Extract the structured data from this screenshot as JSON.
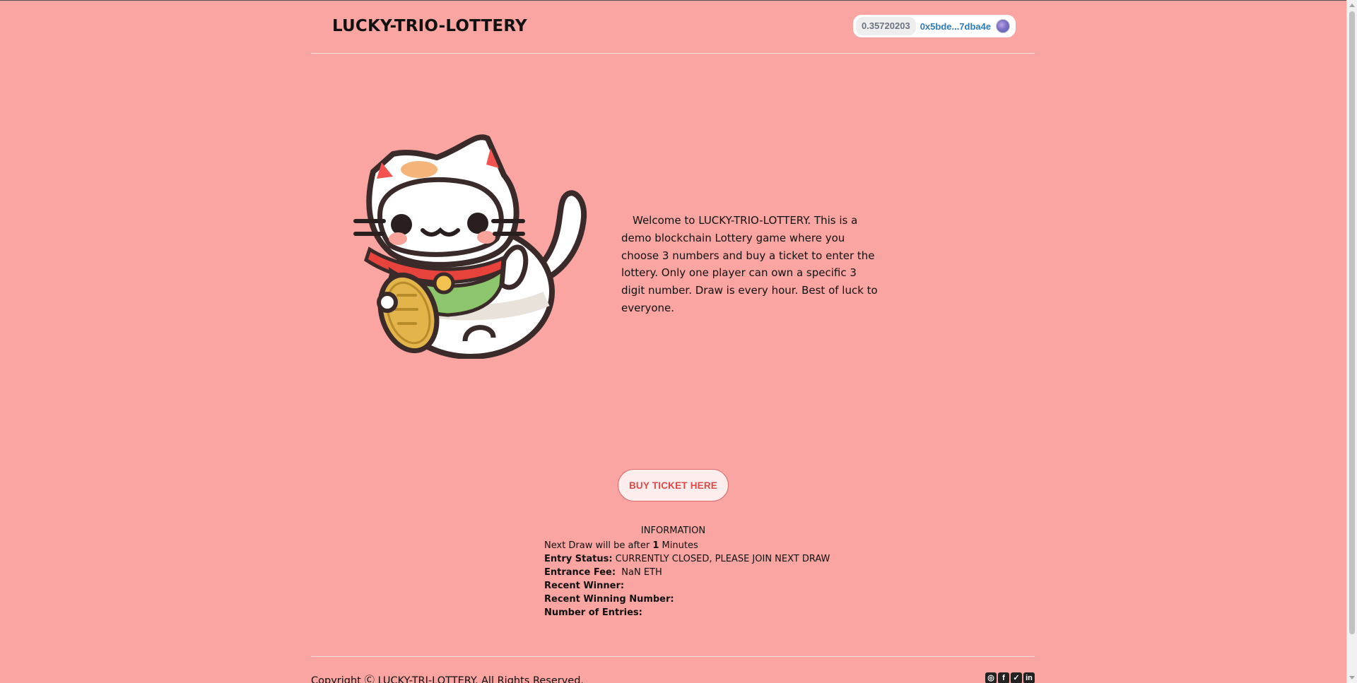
{
  "header": {
    "title": "LUCKY-TRIO-LOTTERY",
    "wallet": {
      "balance": "0.35720203",
      "address": "0x5bde...7dba4e"
    }
  },
  "hero": {
    "welcome_text": "Welcome to LUCKY-TRIO-LOTTERY. This is a demo blockchain Lottery game where you choose 3 numbers and buy a ticket to enter the lottery. Only one player can own a specific 3 digit number. Draw is every hour. Best of luck to everyone.",
    "buy_button": "BUY TICKET HERE"
  },
  "info": {
    "title": "INFORMATION",
    "next_draw_prefix": "Next Draw will be after ",
    "next_draw_value": "1",
    "next_draw_suffix": " Minutes",
    "entry_status_label": "Entry Status:",
    "entry_status_value": "CURRENTLY CLOSED, PLEASE JOIN NEXT DRAW",
    "entrance_fee_label": "Entrance Fee:",
    "entrance_fee_value": "NaN ETH",
    "recent_winner_label": "Recent Winner:",
    "recent_winner_value": "",
    "recent_winning_number_label": "Recent Winning Number:",
    "recent_winning_number_value": "",
    "number_of_entries_label": "Number of Entries:",
    "number_of_entries_value": ""
  },
  "footer": {
    "copyright": "Copyright Ⓒ LUCKY-TRI-LOTTERY. All Rights Reserved.",
    "socials": [
      "instagram-icon",
      "facebook-icon",
      "twitter-icon",
      "linkedin-icon"
    ]
  },
  "colors": {
    "background": "#fba5a3",
    "button_text": "#e04848",
    "address": "#2e7bb8"
  }
}
